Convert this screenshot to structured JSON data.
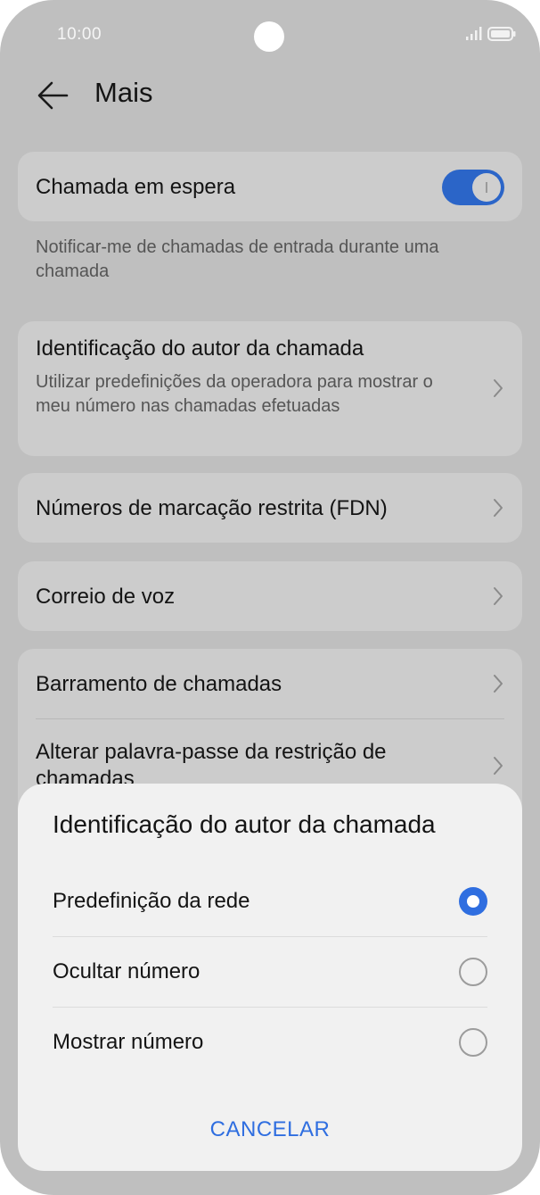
{
  "status_bar": {
    "time": "10:00",
    "signal_icon": "signal-icon",
    "battery_icon": "battery-icon"
  },
  "header": {
    "title": "Mais",
    "back_icon": "arrow-left-icon"
  },
  "call_waiting": {
    "title": "Chamada em espera",
    "enabled": true,
    "note": "Notificar-me de chamadas de entrada durante uma chamada"
  },
  "caller_id": {
    "title": "Identificação do autor da chamada",
    "subtitle": "Utilizar predefinições da operadora para mostrar o meu número nas chamadas efetuadas"
  },
  "fdn": {
    "title": "Números de marcação restrita (FDN)"
  },
  "voicemail": {
    "title": "Correio de voz"
  },
  "barring": {
    "items": [
      {
        "title": "Barramento de chamadas"
      },
      {
        "title": "Alterar palavra-passe da restrição de chamadas"
      }
    ]
  },
  "sheet": {
    "title": "Identificação do autor da chamada",
    "options": [
      {
        "label": "Predefinição da rede",
        "selected": true
      },
      {
        "label": "Ocultar número",
        "selected": false
      },
      {
        "label": "Mostrar número",
        "selected": false
      }
    ],
    "cancel_label": "CANCELAR"
  },
  "colors": {
    "accent": "#2f6ee0",
    "toggle_on": "#2b65c8",
    "dim_background": "#bfbfbf",
    "sheet_background": "#f1f1f1"
  }
}
